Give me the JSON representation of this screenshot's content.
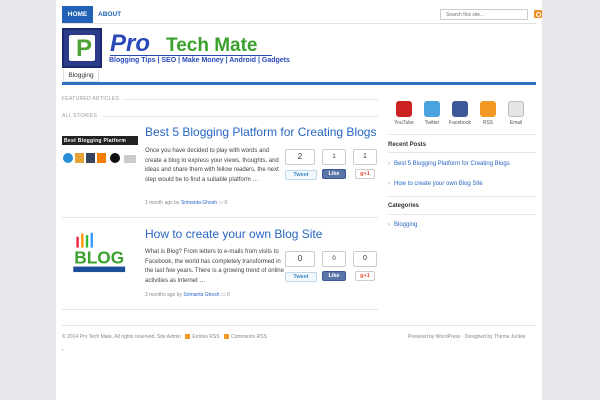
{
  "nav": {
    "home": "HOME",
    "about": "ABOUT"
  },
  "search": {
    "placeholder": "Search this site..."
  },
  "logo": {
    "letter": "P",
    "pro": "Pro",
    "techmate": "Tech Mate",
    "tagline": "Blogging Tips | SEO | Make Money | Android | Gadgets"
  },
  "category_tab": "Blogging",
  "sections": {
    "featured": "FEATURED ARTICLES",
    "all": "ALL STORIES"
  },
  "posts": [
    {
      "title": "Best 5 Blogging Platform for Creating Blogs",
      "excerpt": "Once you have decided to play with words and create a blog to express your views, thoughts, and ideas and share them with fellow readers, the next step would be to find a suitable platform …",
      "meta_time": "1 month ago by",
      "author": "Srimanta Ghosh",
      "comments": "0",
      "tweet_count": "2",
      "like_count": "1",
      "gplus_count": "1",
      "thumb_label": "Best Blogging Platform"
    },
    {
      "title": "How to create your own Blog Site",
      "excerpt": "What is Blog? From letters to e-mails from visits to Facebook, the world has completely transformed in the last few years. There is a growing trend of online activities as internet …",
      "meta_time": "2 months ago by",
      "author": "Srimanta Ghosh",
      "comments": "0",
      "tweet_count": "0",
      "like_count": "0",
      "gplus_count": "0",
      "thumb_label": "BLOG"
    }
  ],
  "social_labels": {
    "tweet": "Tweet",
    "like": "Like",
    "gplus": "g+1"
  },
  "sidebar": {
    "icons": [
      {
        "label": "YouTube",
        "icon": "youtube-icon",
        "color": "#cc2222"
      },
      {
        "label": "Twitter",
        "icon": "twitter-icon",
        "color": "#4aa3df"
      },
      {
        "label": "Facebook",
        "icon": "facebook-icon",
        "color": "#3b5998"
      },
      {
        "label": "RSS",
        "icon": "rss-icon",
        "color": "#f39a26"
      },
      {
        "label": "Email",
        "icon": "email-icon",
        "color": "#bbbbbb"
      }
    ],
    "recent_heading": "Recent Posts",
    "recent": [
      "Best 5 Blogging Platform for Creating Blogs",
      "How to create your own Blog Site"
    ],
    "categories_heading": "Categories",
    "categories": [
      "Blogging"
    ]
  },
  "footer": {
    "copyright": "© 2014 Pro Tech Mate. All rights reserved. Site Admin",
    "entries_rss": "Entries RSS",
    "comments_rss": "Comments RSS",
    "credit": "Powered by WordPress · Designed by Theme Junkie"
  }
}
